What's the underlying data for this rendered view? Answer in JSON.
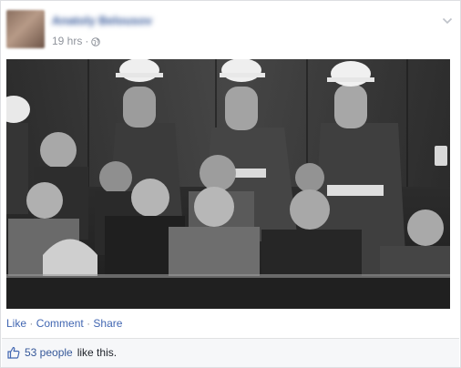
{
  "post": {
    "author_name": "Anatoly Belousov",
    "timestamp": "19 hrs",
    "meta_separator": "·",
    "privacy_icon": "globe-icon",
    "menu_icon": "chevron-down-icon"
  },
  "photo": {
    "kind": "black-and-white group photograph"
  },
  "actions": {
    "like": "Like",
    "comment": "Comment",
    "share": "Share",
    "separator": "·"
  },
  "likes": {
    "icon": "thumbs-up-icon",
    "count_text": "53 people",
    "suffix": "like this."
  },
  "colors": {
    "link": "#4267b2",
    "name": "#365899",
    "meta": "#90949c",
    "likes_bg": "#f6f7f9"
  }
}
